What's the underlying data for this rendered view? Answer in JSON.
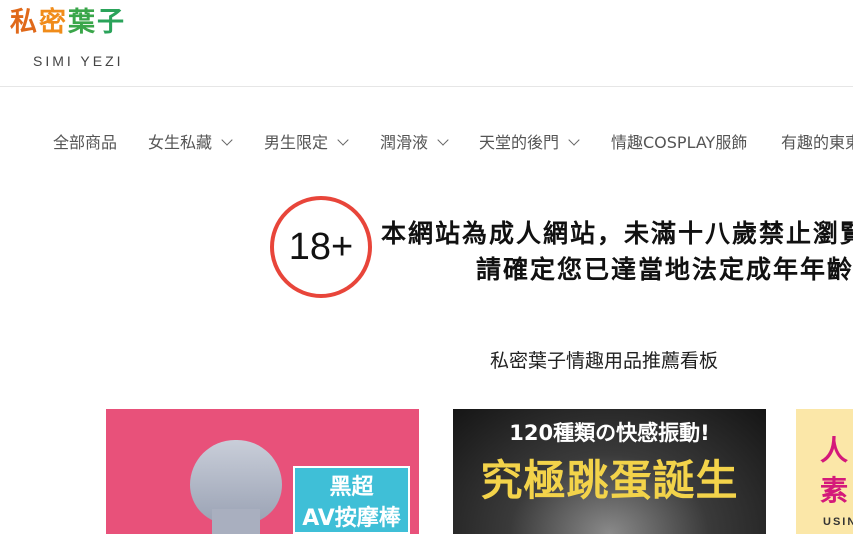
{
  "site": {
    "logo_chars": [
      "私",
      "密",
      "葉",
      "子"
    ],
    "tagline": "SIMI YEZI",
    "colors": {
      "logo_orange": "#e0691a",
      "logo_green": "#3aa64a",
      "badge_red": "#e8453a"
    }
  },
  "nav": {
    "items": [
      {
        "label": "全部商品",
        "has_dropdown": false
      },
      {
        "label": "女生私藏",
        "has_dropdown": true
      },
      {
        "label": "男生限定",
        "has_dropdown": true
      },
      {
        "label": "潤滑液",
        "has_dropdown": true
      },
      {
        "label": "天堂的後門",
        "has_dropdown": true
      },
      {
        "label": "情趣COSPLAY服飾",
        "has_dropdown": false
      },
      {
        "label": "有趣的東東",
        "has_dropdown": false
      }
    ]
  },
  "age_notice": {
    "badge": "18+",
    "line1": "本網站為成人網站，未滿十八歲禁止瀏覽",
    "line2": "請確定您已達當地法定成年年齡"
  },
  "section": {
    "title": "私密葉子情趣用品推薦看板"
  },
  "cards": [
    {
      "line1": "黑超",
      "line2": "AV按摩棒",
      "background": "#e8517a"
    },
    {
      "top_text": "120種類の快感振動!",
      "main_text": "究極跳蛋誕生",
      "background": "#2a2a2a"
    },
    {
      "line1": "人",
      "line2": "素",
      "line3": "USIN",
      "background": "#fbe7a8"
    }
  ]
}
